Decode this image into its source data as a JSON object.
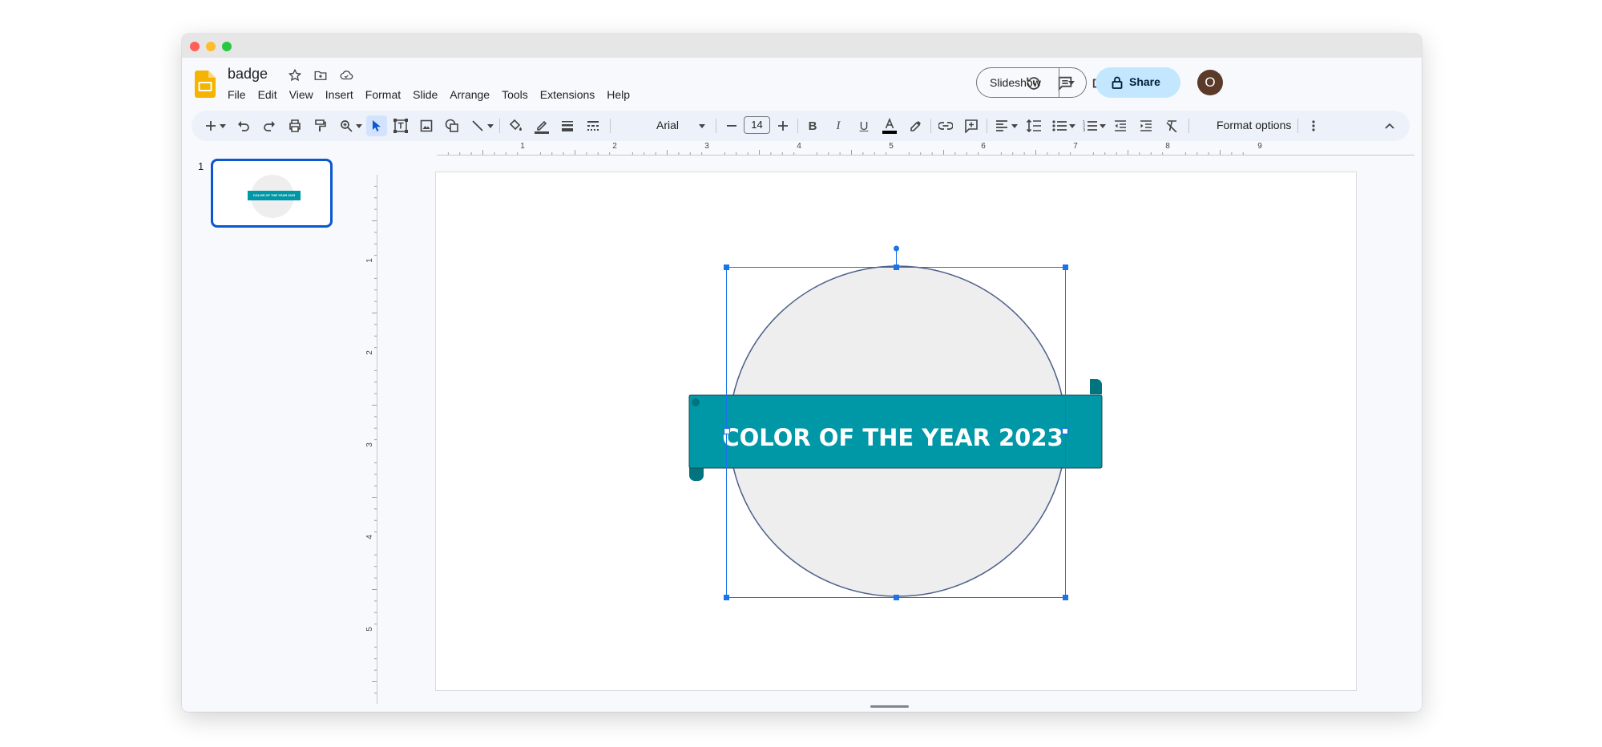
{
  "window": {
    "traffic_lights": [
      "#ff5f57",
      "#febc2e",
      "#28c840"
    ]
  },
  "app": {
    "title": "badge",
    "menu": [
      "File",
      "Edit",
      "View",
      "Insert",
      "Format",
      "Slide",
      "Arrange",
      "Tools",
      "Extensions",
      "Help"
    ],
    "slideshow_label": "Slideshow",
    "share_label": "Share",
    "avatar_letter": "O"
  },
  "toolbar": {
    "font_name": "Arial",
    "font_size": "14",
    "format_options_label": "Format options",
    "icons": [
      "plus-icon",
      "undo-icon",
      "redo-icon",
      "print-icon",
      "paint-format-icon",
      "zoom-icon",
      "select-icon",
      "text-box-icon",
      "image-icon",
      "shape-icon",
      "line-icon",
      "fill-color-icon",
      "border-color-icon",
      "border-weight-icon",
      "border-dash-icon",
      "bold-icon",
      "italic-icon",
      "underline-icon",
      "text-color-icon",
      "highlight-icon",
      "link-icon",
      "comment-icon",
      "align-icon",
      "line-spacing-icon",
      "bullet-list-icon",
      "numbered-list-icon",
      "decrease-indent-icon",
      "increase-indent-icon",
      "clear-formatting-icon",
      "more-icon",
      "collapse-icon"
    ]
  },
  "filmstrip": {
    "slides": [
      {
        "number": "1",
        "thumb_text": "COLOR OF THE YEAR 2023"
      }
    ]
  },
  "rulers": {
    "horizontal_labels": [
      "1",
      "2",
      "3",
      "4",
      "5",
      "6",
      "7",
      "8",
      "9"
    ],
    "vertical_labels": [
      "1",
      "2",
      "3",
      "4",
      "5"
    ]
  },
  "slide": {
    "banner_text": "COLOR OF THE YEAR 2023",
    "colors": {
      "circle_fill": "#eeeeee",
      "circle_stroke": "#4d5f8c",
      "banner_fill": "#0097a7",
      "banner_dark": "#00747f",
      "banner_text": "#ffffff",
      "selection": "#1a73e8"
    }
  }
}
